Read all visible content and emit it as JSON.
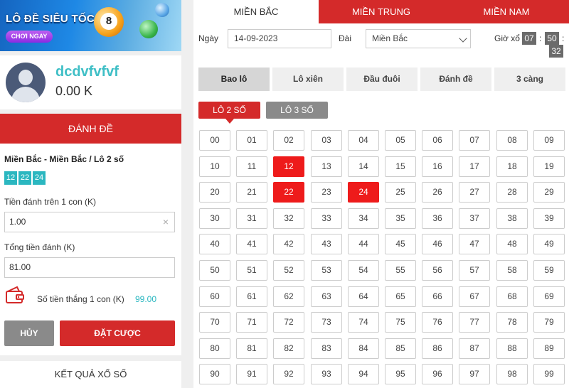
{
  "banner": {
    "title": "LÔ ĐỀ SIÊU TỐC",
    "button_label": "CHƠI NGAY",
    "ball_number": "8"
  },
  "user": {
    "name": "dcdvfvfvf",
    "balance": "0.00 K"
  },
  "bet": {
    "header": "ĐÁNH ĐỀ",
    "summary": "Miền Bắc - Miền Bắc / Lô 2 số",
    "chips": [
      "12",
      "22",
      "24"
    ],
    "stake_label": "Tiền đánh trên 1 con (K)",
    "stake_value": "1.00",
    "clear_symbol": "×",
    "total_label": "Tổng tiền đánh (K)",
    "total_value": "81.00",
    "win_label": "Số tiền thắng 1 con (K)",
    "win_value": "99.00",
    "cancel_label": "HỦY",
    "place_label": "ĐẶT CƯỢC"
  },
  "results_label": "KẾT QUẢ XỔ SỐ",
  "regions": [
    {
      "label": "MIỀN BẮC",
      "active": true
    },
    {
      "label": "MIỀN TRUNG",
      "active": false
    },
    {
      "label": "MIỀN NAM",
      "active": false
    }
  ],
  "filters": {
    "date_label": "Ngày",
    "date_value": "14-09-2023",
    "station_label": "Đài",
    "station_value": "Miền Bắc",
    "time_label": "Giờ xổ",
    "hours": "07",
    "minutes": "50",
    "seconds": "32",
    "separator": ":"
  },
  "bet_types": [
    {
      "label": "Bao lô",
      "active": true
    },
    {
      "label": "Lô xiên",
      "active": false
    },
    {
      "label": "Đầu đuôi",
      "active": false
    },
    {
      "label": "Đánh đề",
      "active": false
    },
    {
      "label": "3 càng",
      "active": false
    }
  ],
  "sub_tabs": [
    {
      "label": "LÔ 2 SỐ",
      "active": true
    },
    {
      "label": "LÔ 3 SỐ",
      "active": false
    }
  ],
  "selected_numbers": [
    "12",
    "22",
    "24"
  ],
  "colors": {
    "brand_red": "#d42a2a",
    "selected_red": "#ee1b1b",
    "accent_teal": "#2bb7c0"
  }
}
